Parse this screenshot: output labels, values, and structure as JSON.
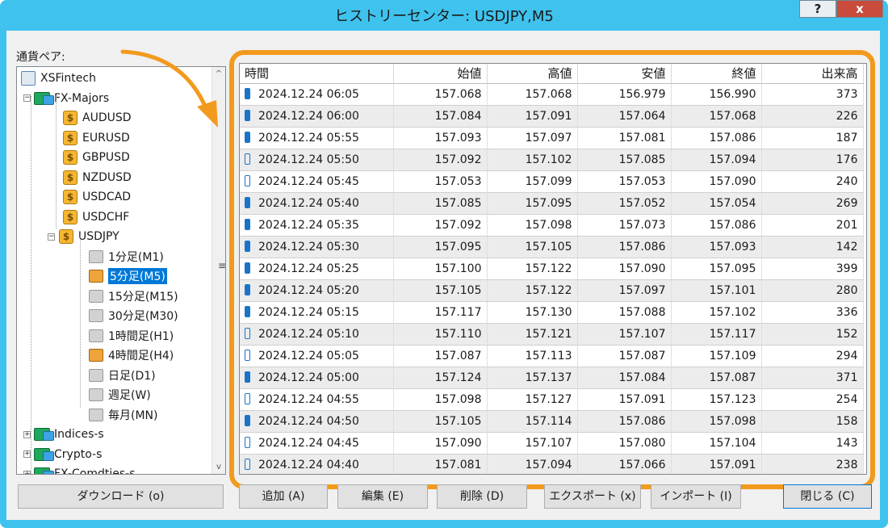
{
  "window": {
    "title": "ヒストリーセンター: USDJPY,M5",
    "help_label": "?",
    "close_label": "x"
  },
  "pair_label": "通貨ペア:",
  "tree": {
    "root": "XSFintech",
    "groups": [
      {
        "label": "FX-Majors"
      },
      {
        "label": "Indices-s"
      },
      {
        "label": "Crypto-s"
      },
      {
        "label": "FX-Comdties-s"
      }
    ],
    "symbols": [
      "AUDUSD",
      "EURUSD",
      "GBPUSD",
      "NZDUSD",
      "USDCAD",
      "USDCHF",
      "USDJPY"
    ],
    "timeframes": [
      "1分足(M1)",
      "5分足(M5)",
      "15分足(M15)",
      "30分足(M30)",
      "1時間足(H1)",
      "4時間足(H4)",
      "日足(D1)",
      "週足(W)",
      "毎月(MN)"
    ],
    "selected_timeframe": "5分足(M5)",
    "scroll_up": "^",
    "scroll_down": "v",
    "splitter": "≡"
  },
  "grid": {
    "headers": [
      "時間",
      "始値",
      "高値",
      "安値",
      "終値",
      "出来高"
    ],
    "rows": [
      {
        "time": "2024.12.24 06:05",
        "open": "157.068",
        "high": "157.068",
        "low": "156.979",
        "close": "156.990",
        "volume": "373",
        "filled": true
      },
      {
        "time": "2024.12.24 06:00",
        "open": "157.084",
        "high": "157.091",
        "low": "157.064",
        "close": "157.068",
        "volume": "226",
        "filled": true
      },
      {
        "time": "2024.12.24 05:55",
        "open": "157.093",
        "high": "157.097",
        "low": "157.081",
        "close": "157.086",
        "volume": "187",
        "filled": true
      },
      {
        "time": "2024.12.24 05:50",
        "open": "157.092",
        "high": "157.102",
        "low": "157.085",
        "close": "157.094",
        "volume": "176",
        "filled": false
      },
      {
        "time": "2024.12.24 05:45",
        "open": "157.053",
        "high": "157.099",
        "low": "157.053",
        "close": "157.090",
        "volume": "240",
        "filled": false
      },
      {
        "time": "2024.12.24 05:40",
        "open": "157.085",
        "high": "157.095",
        "low": "157.052",
        "close": "157.054",
        "volume": "269",
        "filled": true
      },
      {
        "time": "2024.12.24 05:35",
        "open": "157.092",
        "high": "157.098",
        "low": "157.073",
        "close": "157.086",
        "volume": "201",
        "filled": true
      },
      {
        "time": "2024.12.24 05:30",
        "open": "157.095",
        "high": "157.105",
        "low": "157.086",
        "close": "157.093",
        "volume": "142",
        "filled": true
      },
      {
        "time": "2024.12.24 05:25",
        "open": "157.100",
        "high": "157.122",
        "low": "157.090",
        "close": "157.095",
        "volume": "399",
        "filled": true
      },
      {
        "time": "2024.12.24 05:20",
        "open": "157.105",
        "high": "157.122",
        "low": "157.097",
        "close": "157.101",
        "volume": "280",
        "filled": true
      },
      {
        "time": "2024.12.24 05:15",
        "open": "157.117",
        "high": "157.130",
        "low": "157.088",
        "close": "157.102",
        "volume": "336",
        "filled": true
      },
      {
        "time": "2024.12.24 05:10",
        "open": "157.110",
        "high": "157.121",
        "low": "157.107",
        "close": "157.117",
        "volume": "152",
        "filled": false
      },
      {
        "time": "2024.12.24 05:05",
        "open": "157.087",
        "high": "157.113",
        "low": "157.087",
        "close": "157.109",
        "volume": "294",
        "filled": false
      },
      {
        "time": "2024.12.24 05:00",
        "open": "157.124",
        "high": "157.137",
        "low": "157.084",
        "close": "157.087",
        "volume": "371",
        "filled": true
      },
      {
        "time": "2024.12.24 04:55",
        "open": "157.098",
        "high": "157.127",
        "low": "157.091",
        "close": "157.123",
        "volume": "254",
        "filled": false
      },
      {
        "time": "2024.12.24 04:50",
        "open": "157.105",
        "high": "157.114",
        "low": "157.086",
        "close": "157.098",
        "volume": "158",
        "filled": true
      },
      {
        "time": "2024.12.24 04:45",
        "open": "157.090",
        "high": "157.107",
        "low": "157.080",
        "close": "157.104",
        "volume": "143",
        "filled": false
      },
      {
        "time": "2024.12.24 04:40",
        "open": "157.081",
        "high": "157.094",
        "low": "157.066",
        "close": "157.091",
        "volume": "238",
        "filled": false
      }
    ]
  },
  "buttons": {
    "download": "ダウンロード (o)",
    "add": "追加 (A)",
    "edit": "編集 (E)",
    "delete": "削除 (D)",
    "export": "エクスポート (x)",
    "import": "インポート (I)",
    "close": "閉じる (C)"
  },
  "colors": {
    "frame": "#3fc3ee",
    "highlight": "#f29a1d",
    "selection": "#0078d7",
    "candle": "#1a73c8"
  }
}
